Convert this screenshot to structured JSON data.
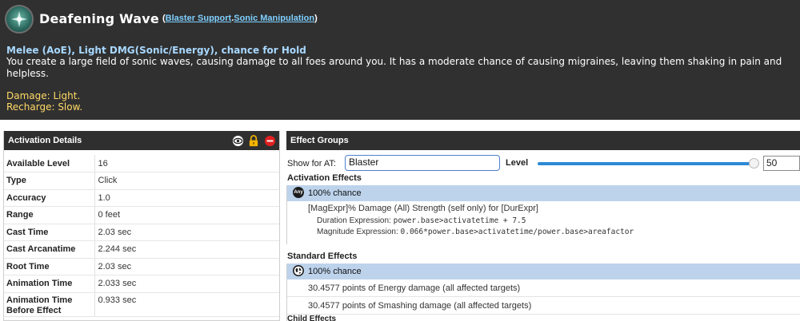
{
  "power": {
    "title": "Deafening Wave",
    "powerset_open": "(",
    "powerset_category": "Blaster Support",
    "powerset_sep": ".",
    "powerset_name": "Sonic Manipulation",
    "powerset_close": ")",
    "tagline": "Melee (AoE), Light DMG(Sonic/Energy), chance for Hold",
    "description": "You create a large field of sonic waves, causing damage to all foes around you. It has a moderate chance of causing migraines, leaving them shaking in pain and helpless.",
    "damage": "Damage: Light.",
    "recharge": "Recharge: Slow."
  },
  "activation_details": {
    "header": "Activation Details",
    "icons": [
      "eye-icon",
      "lock-icon",
      "minus-circle-icon"
    ],
    "rows": [
      {
        "label": "Available Level",
        "value": "16"
      },
      {
        "label": "Type",
        "value": "Click"
      },
      {
        "label": "Accuracy",
        "value": "1.0"
      },
      {
        "label": "Range",
        "value": "0 feet"
      },
      {
        "label": "Cast Time",
        "value": "2.03 sec"
      },
      {
        "label": "Cast Arcanatime",
        "value": "2.244 sec"
      },
      {
        "label": "Root Time",
        "value": "2.03 sec"
      },
      {
        "label": "Animation Time",
        "value": "2.033 sec"
      },
      {
        "label": "Animation Time Before Effect",
        "value": "0.933 sec"
      }
    ]
  },
  "effect_groups": {
    "header": "Effect Groups",
    "at_label": "Show for AT:",
    "at_value": "Blaster",
    "level_label": "Level",
    "level_value": "50",
    "level_fraction": 1.0,
    "activation_title": "Activation Effects",
    "activation_group": {
      "chance": "100% chance",
      "icon_text": "Any",
      "effect": "[MagExpr]% Damage (All) Strength (self only) for [DurExpr]",
      "duration_label": "Duration Expression: ",
      "duration_expr": "power.base>activatetime + 7.5",
      "magnitude_label": "Magnitude Expression: ",
      "magnitude_expr": "0.066*power.base>activatetime/power.base>areafactor"
    },
    "standard_title": "Standard Effects",
    "standard_group": {
      "chance": "100% chance",
      "effects": [
        "30.4577 points of Energy damage (all affected targets)",
        "30.4577 points of Smashing damage (all affected targets)"
      ]
    },
    "child_title": "Child Effects"
  },
  "colors": {
    "header_bg": "#303030",
    "link": "#7fd0ff",
    "tagline": "#a8d8ff",
    "stat": "#ffd966",
    "chance_bar": "#bdd3ec",
    "slider": "#2d89d6",
    "lock": "#f2b400",
    "remove": "#e02020"
  }
}
